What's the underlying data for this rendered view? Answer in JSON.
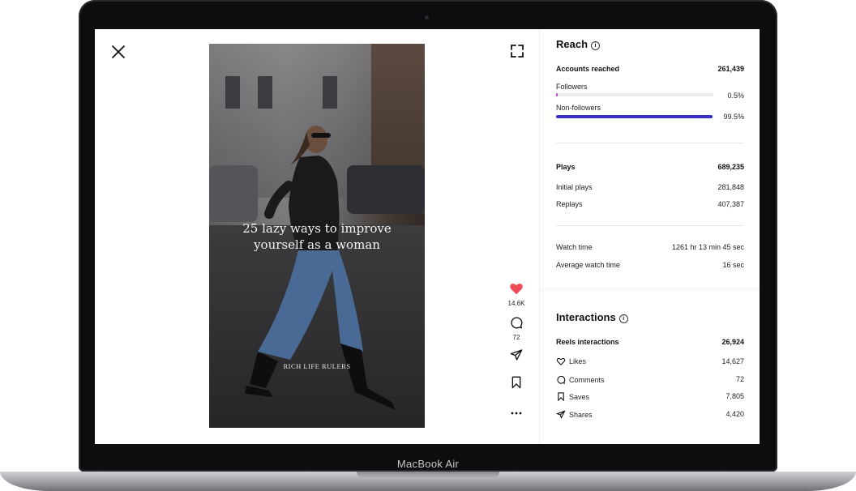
{
  "device": {
    "label": "MacBook Air"
  },
  "reel": {
    "title_line1": "25 lazy ways to improve",
    "title_line2": "yourself as a woman",
    "brand": "RICH LIFE RULERS"
  },
  "actions": {
    "likes_count": "14.6K",
    "comments_count": "72"
  },
  "icons": {
    "close": "close-icon",
    "expand": "expand-icon",
    "like": "heart-icon",
    "comment": "comment-icon",
    "share": "send-icon",
    "save": "bookmark-icon",
    "more": "more-icon"
  },
  "colors": {
    "like_red": "#ed4956",
    "reach_bar": "#3b2fc9",
    "followers_bar": "#c23bd4"
  },
  "reach": {
    "title": "Reach",
    "accounts_label": "Accounts reached",
    "accounts_value": "261,439",
    "followers_label": "Followers",
    "followers_value": "0.5%",
    "followers_fraction": 0.005,
    "nonfollowers_label": "Non-followers",
    "nonfollowers_value": "99.5%",
    "nonfollowers_fraction": 0.995,
    "plays_label": "Plays",
    "plays_value": "689,235",
    "initial_plays_label": "Initial plays",
    "initial_plays_value": "281,848",
    "replays_label": "Replays",
    "replays_value": "407,387",
    "watch_time_label": "Watch time",
    "watch_time_value": "1261 hr 13 min 45 sec",
    "avg_watch_label": "Average watch time",
    "avg_watch_value": "16 sec"
  },
  "interactions": {
    "title": "Interactions",
    "reels_label": "Reels interactions",
    "reels_value": "26,924",
    "likes_label": "Likes",
    "likes_value": "14,627",
    "comments_label": "Comments",
    "comments_value": "72",
    "saves_label": "Saves",
    "saves_value": "7,805",
    "shares_label": "Shares",
    "shares_value": "4,420"
  }
}
